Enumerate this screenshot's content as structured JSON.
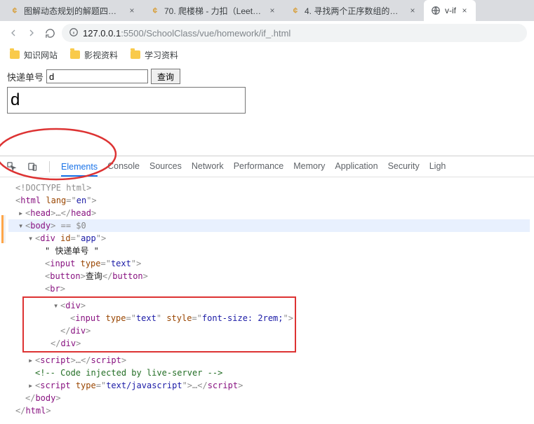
{
  "tabs": [
    {
      "title": "图解动态规划的解题四步骤（C+",
      "favicon": "lc"
    },
    {
      "title": "70. 爬楼梯 - 力扣（LeetCode）",
      "favicon": "lc"
    },
    {
      "title": "4. 寻找两个正序数组的中位数 -",
      "favicon": "lc"
    },
    {
      "title": "v-if",
      "favicon": "globe",
      "active": true
    }
  ],
  "address": {
    "info_icon": "ⓘ",
    "host": "127.0.0.1",
    "port": ":5500",
    "path": "/SchoolClass/vue/homework/if_.html"
  },
  "bookmarks": [
    {
      "label": "知识网站"
    },
    {
      "label": "影视资料"
    },
    {
      "label": "学习资料"
    }
  ],
  "page": {
    "label": "快递单号",
    "input_value": "d",
    "button_label": "查询",
    "big_input_value": "d"
  },
  "devtools": {
    "tabs": [
      "Elements",
      "Console",
      "Sources",
      "Network",
      "Performance",
      "Memory",
      "Application",
      "Security",
      "Ligh"
    ],
    "active_tab_index": 0,
    "selection_suffix": "== $0",
    "dom": {
      "doctype": "<!DOCTYPE html>",
      "html_lang": "en",
      "head_ellipsis": "…",
      "body_tag": "body",
      "app_id": "app",
      "app_text": "\" 快递单号 \"",
      "input_type": "text",
      "button_text": "查询",
      "br": "br",
      "inner_input_style": "font-size: 2rem;",
      "comment": "<!-- Code injected by live-server -->",
      "script2_type": "text/javascript"
    }
  }
}
